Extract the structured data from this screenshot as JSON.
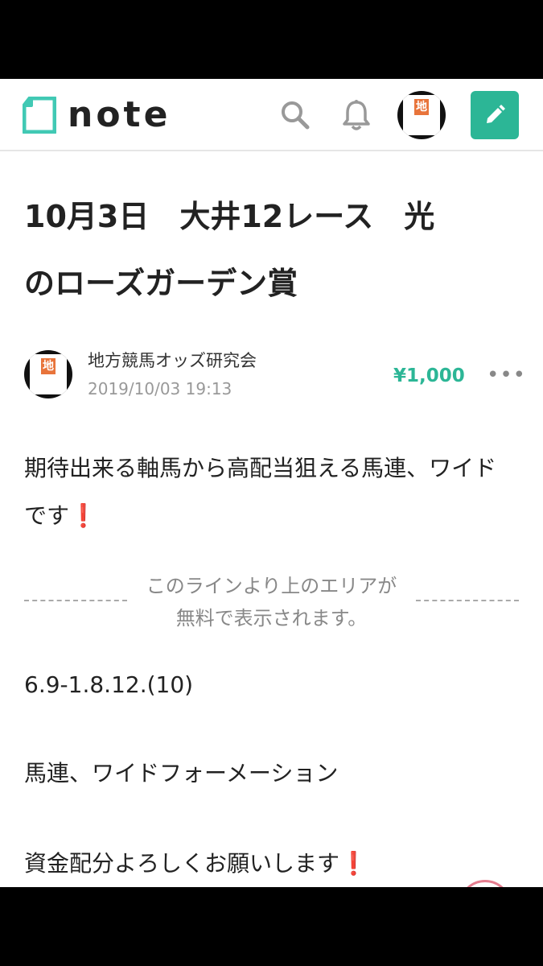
{
  "header": {
    "logo_text": "note",
    "icons": {
      "logo": "note-logo-icon",
      "search": "search-icon",
      "bell": "bell-icon",
      "edit": "pencil-icon"
    },
    "avatar_label": "地"
  },
  "article": {
    "title_lines": [
      "10月3日　大井12レース　光",
      "のローズガーデン賞"
    ],
    "author": {
      "name": "地方競馬オッズ研究会",
      "date": "2019/10/03 19:13",
      "avatar_label": "地"
    },
    "price": "¥1,000",
    "more": "•••",
    "intro": [
      "期待出来る軸馬から高配当狙える馬連、ワイド",
      "です"
    ],
    "free_notice": [
      "このラインより上のエリアが",
      "無料で表示されます。"
    ],
    "lines": [
      "6.9-1.8.12.(10)",
      "馬連、ワイドフォーメーション",
      "資金配分よろしくお願いします"
    ],
    "mark": "❗"
  },
  "colors": {
    "accent": "#2cb696",
    "mark": "#d0021b",
    "avatar_orange": "#e8743b"
  }
}
